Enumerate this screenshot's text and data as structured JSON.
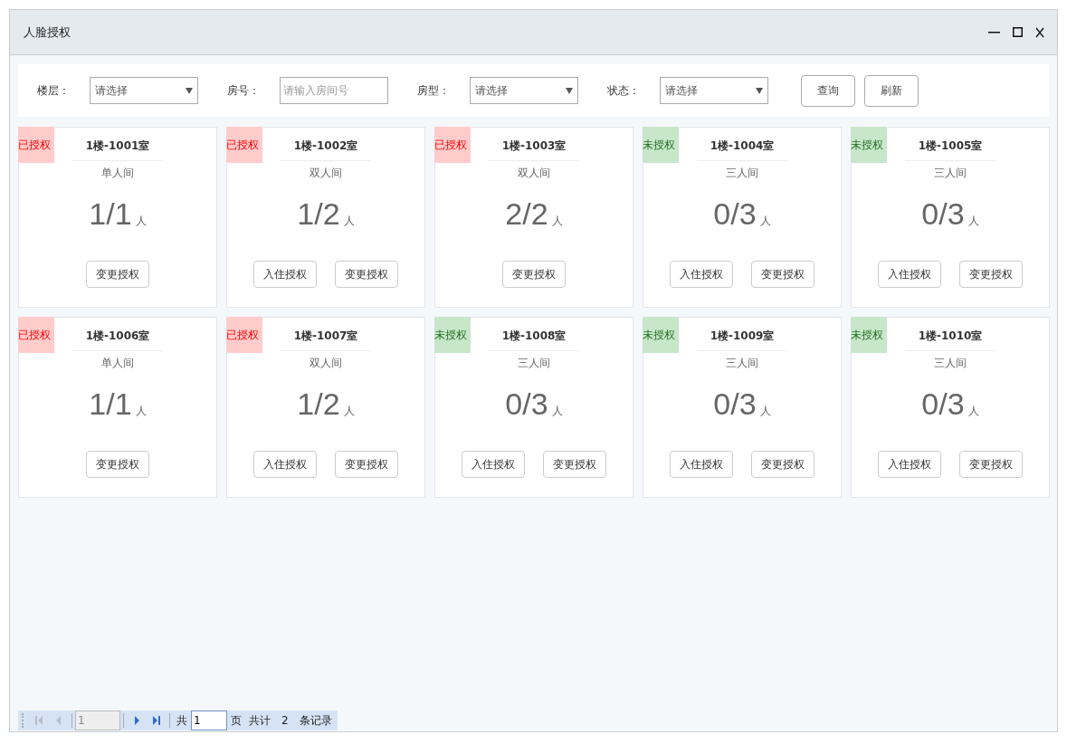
{
  "window": {
    "title": "人脸授权"
  },
  "filters": [
    {
      "kind": "select",
      "label": "楼层：",
      "value": "请选择"
    },
    {
      "kind": "input",
      "label": "房号：",
      "placeholder": "请输入房间号"
    },
    {
      "kind": "select",
      "label": "房型：",
      "value": "请选择"
    },
    {
      "kind": "select",
      "label": "状态：",
      "value": "请选择"
    }
  ],
  "filter_buttons": [
    "查询",
    "刷新"
  ],
  "rooms": [
    {
      "status": "已授权",
      "authorized": true,
      "name": "1楼-1001室",
      "type": "单人间",
      "count": "1/1",
      "unit": "人",
      "buttons": [
        "变更授权"
      ]
    },
    {
      "status": "已授权",
      "authorized": true,
      "name": "1楼-1002室",
      "type": "双人间",
      "count": "1/2",
      "unit": "人",
      "buttons": [
        "入住授权",
        "变更授权"
      ]
    },
    {
      "status": "已授权",
      "authorized": true,
      "name": "1楼-1003室",
      "type": "双人间",
      "count": "2/2",
      "unit": "人",
      "buttons": [
        "变更授权"
      ]
    },
    {
      "status": "未授权",
      "authorized": false,
      "name": "1楼-1004室",
      "type": "三人间",
      "count": "0/3",
      "unit": "人",
      "buttons": [
        "入住授权",
        "变更授权"
      ]
    },
    {
      "status": "未授权",
      "authorized": false,
      "name": "1楼-1005室",
      "type": "三人间",
      "count": "0/3",
      "unit": "人",
      "buttons": [
        "入住授权",
        "变更授权"
      ]
    },
    {
      "status": "已授权",
      "authorized": true,
      "name": "1楼-1006室",
      "type": "单人间",
      "count": "1/1",
      "unit": "人",
      "buttons": [
        "变更授权"
      ]
    },
    {
      "status": "已授权",
      "authorized": true,
      "name": "1楼-1007室",
      "type": "双人间",
      "count": "1/2",
      "unit": "人",
      "buttons": [
        "入住授权",
        "变更授权"
      ]
    },
    {
      "status": "未授权",
      "authorized": false,
      "name": "1楼-1008室",
      "type": "三人间",
      "count": "0/3",
      "unit": "人",
      "buttons": [
        "入住授权",
        "变更授权"
      ]
    },
    {
      "status": "未授权",
      "authorized": false,
      "name": "1楼-1009室",
      "type": "三人间",
      "count": "0/3",
      "unit": "人",
      "buttons": [
        "入住授权",
        "变更授权"
      ]
    },
    {
      "status": "未授权",
      "authorized": false,
      "name": "1楼-1010室",
      "type": "三人间",
      "count": "0/3",
      "unit": "人",
      "buttons": [
        "入住授权",
        "变更授权"
      ]
    }
  ],
  "pager": {
    "current_page": "1",
    "total_prefix": "共",
    "total_pages": "1",
    "pages_suffix": "页",
    "records_prefix": "共计",
    "records": "2",
    "records_suffix": "条记录"
  }
}
